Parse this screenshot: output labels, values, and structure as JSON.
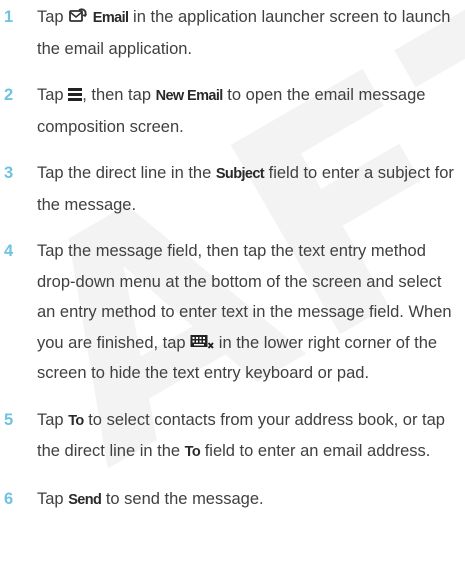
{
  "watermark": "AFT",
  "steps": [
    {
      "number": "1",
      "t1": "Tap ",
      "icon": "email-app-icon",
      "key1": "Email",
      "t2": " in the application launcher screen to launch the email application."
    },
    {
      "number": "2",
      "t1": "Tap ",
      "icon": "menu-icon",
      "t2": ", then tap ",
      "key1": "New Email",
      "t3": " to open the email message composition screen."
    },
    {
      "number": "3",
      "t1": "Tap the direct line in the ",
      "key1": "Subject",
      "t2": " field to enter a subject for the message."
    },
    {
      "number": "4",
      "t1": "Tap the message field, then tap the text entry method drop-down menu at the bottom of the screen and select an entry method to enter text in the message field. When you are finished, tap ",
      "icon": "hide-keyboard-icon",
      "t2": " in the lower right corner of the screen to hide the text entry keyboard or pad."
    },
    {
      "number": "5",
      "t1": "Tap ",
      "key1": "To",
      "t2": " to select contacts from your address book, or tap the direct line in the ",
      "key2": "To",
      "t3": " field to enter an email address."
    },
    {
      "number": "6",
      "t1": "Tap ",
      "key1": "Send",
      "t2": " to send the message."
    }
  ],
  "colors": {
    "step_number": "#6fc3e0",
    "body_text": "#404040",
    "watermark": "#f3f3f3"
  }
}
